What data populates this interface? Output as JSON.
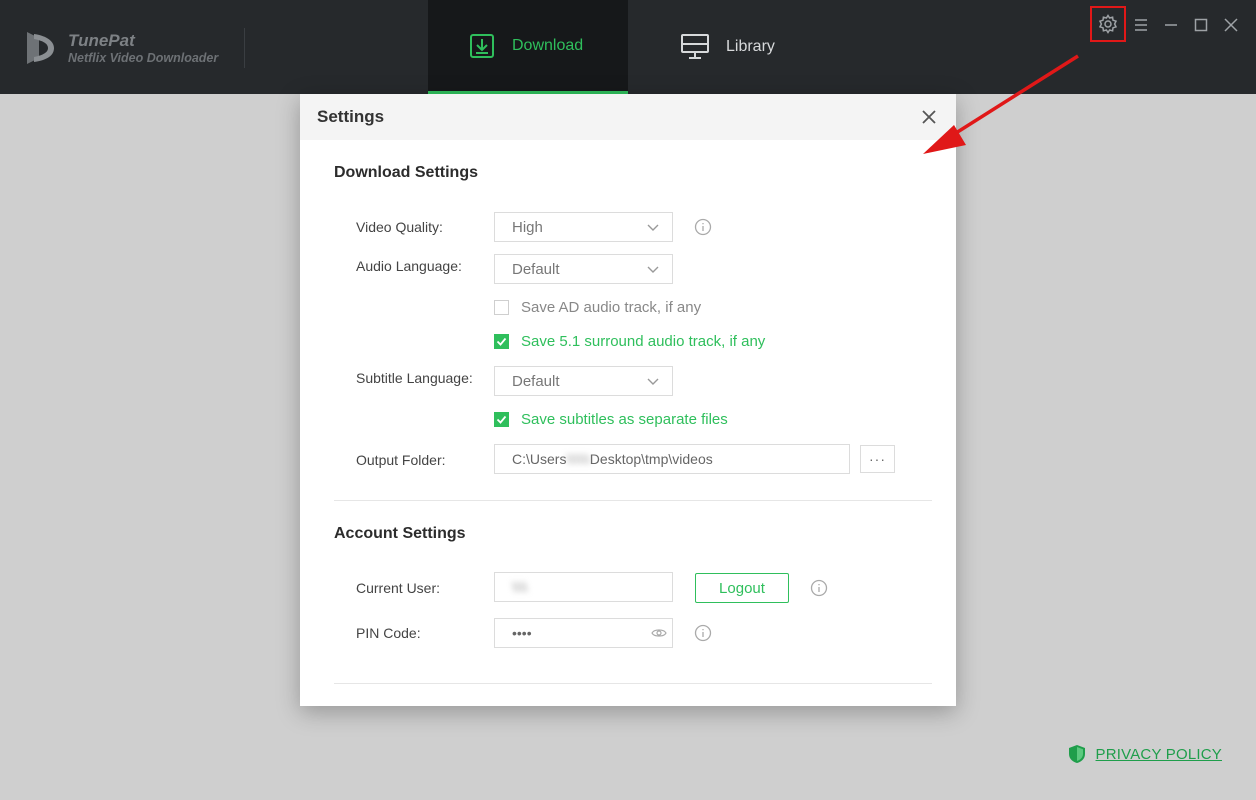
{
  "app": {
    "name": "TunePat",
    "subtitle": "Netflix Video Downloader"
  },
  "nav": {
    "download_label": "Download",
    "library_label": "Library"
  },
  "colors": {
    "accent": "#2fbf5c",
    "titlebar": "#26292c",
    "highlight_box": "#e01818"
  },
  "settings": {
    "title": "Settings",
    "download_section": "Download Settings",
    "video_quality": {
      "label": "Video Quality:",
      "value": "High"
    },
    "audio_language": {
      "label": "Audio Language:",
      "value": "Default"
    },
    "save_ad_track": {
      "label": "Save AD audio track, if any",
      "checked": false
    },
    "save_surround": {
      "label": "Save 5.1 surround audio track, if any",
      "checked": true
    },
    "subtitle_language": {
      "label": "Subtitle Language:",
      "value": "Default"
    },
    "save_subtitles": {
      "label": "Save subtitles as separate files",
      "checked": true
    },
    "output_folder": {
      "label": "Output Folder:",
      "value_start": "C:\\Users",
      "value_hidden": "\\\\\\\\\\\\",
      "value_end": "Desktop\\tmp\\videos",
      "browse_label": "···"
    },
    "account_section": "Account Settings",
    "current_user": {
      "label": "Current User:",
      "value_hidden": "\\\\\\\\"
    },
    "logout_label": "Logout",
    "pin_code": {
      "label": "PIN Code:",
      "value": "••••"
    }
  },
  "footer": {
    "privacy_label": "PRIVACY POLICY"
  },
  "icons": {
    "settings": "gear-icon",
    "menu": "menu-icon",
    "minimize": "minimize-icon",
    "maximize": "maximize-icon",
    "close": "close-icon",
    "info": "info-icon",
    "eye": "eye-icon",
    "shield": "shield-icon"
  }
}
